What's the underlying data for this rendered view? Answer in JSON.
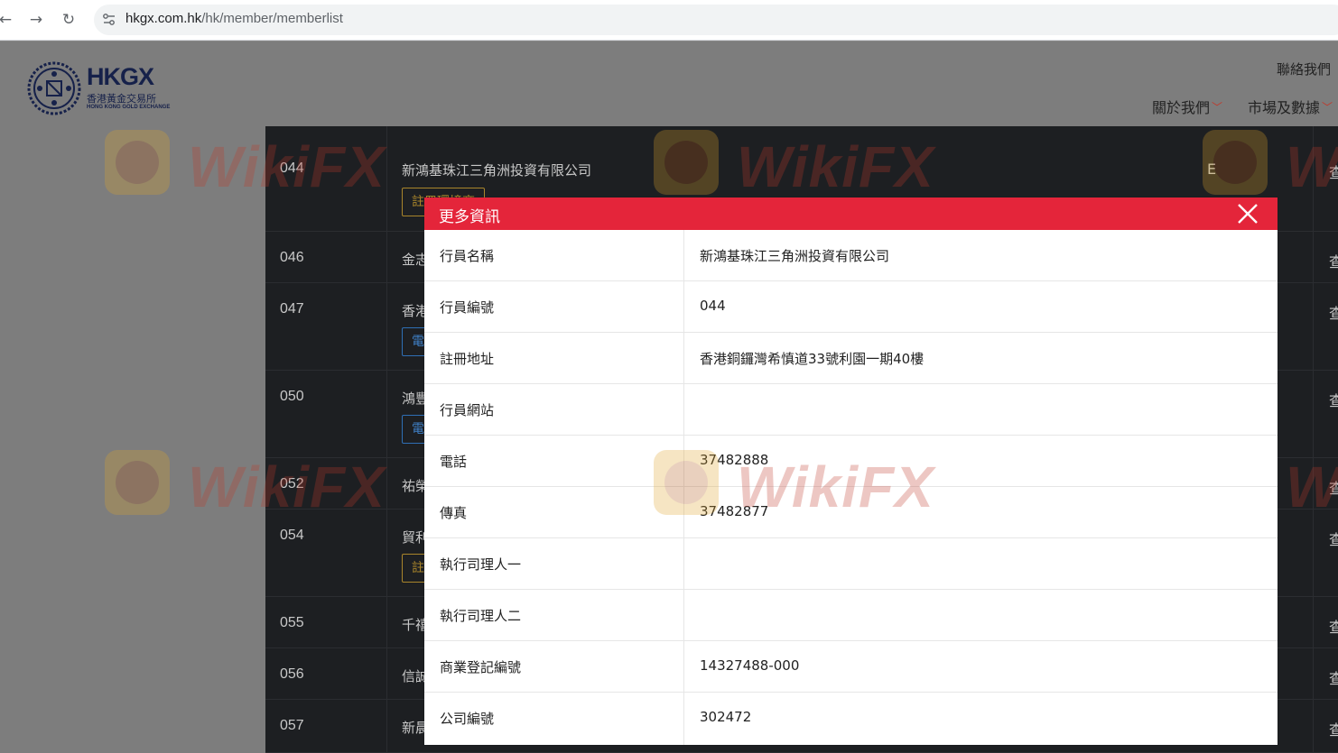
{
  "browser": {
    "url_host": "hkgx.com.hk",
    "url_path": "/hk/member/memberlist"
  },
  "header": {
    "logo_text": "HKGX",
    "logo_cn": "香港黃金交易所",
    "logo_en": "HONG KONG GOLD EXCHANGE",
    "contact": "聯絡我們",
    "nav": [
      {
        "label": "關於我們"
      },
      {
        "label": "市場及數據"
      }
    ]
  },
  "members": [
    {
      "num": "044",
      "name": "新鴻基珠江三角洲投資有限公司",
      "tag": "註冊環境商",
      "tag_type": "gold",
      "trail": "查",
      "extra": "E"
    },
    {
      "num": "046",
      "name": "金志",
      "tag": "",
      "tag_type": "",
      "trail": "查",
      "extra": ""
    },
    {
      "num": "047",
      "name": "香港",
      "tag": "電",
      "tag_type": "blue",
      "trail": "查",
      "extra": ""
    },
    {
      "num": "050",
      "name": "鴻豐",
      "tag": "電",
      "tag_type": "blue",
      "trail": "查",
      "extra": ""
    },
    {
      "num": "052",
      "name": "祐榮",
      "tag": "",
      "tag_type": "",
      "trail": "查",
      "extra": ""
    },
    {
      "num": "054",
      "name": "貿利",
      "tag": "註",
      "tag_type": "gold",
      "trail": "查",
      "extra": ""
    },
    {
      "num": "055",
      "name": "千禧",
      "tag": "",
      "tag_type": "",
      "trail": "查",
      "extra": ""
    },
    {
      "num": "056",
      "name": "信誠",
      "tag": "",
      "tag_type": "",
      "trail": "查",
      "extra": ""
    },
    {
      "num": "057",
      "name": "新晨",
      "tag": "",
      "tag_type": "",
      "trail": "查",
      "extra": ""
    }
  ],
  "watermark": "WikiFX",
  "modal": {
    "title": "更多資訊",
    "rows": [
      {
        "label": "行員名稱",
        "value": "新鴻基珠江三角洲投資有限公司"
      },
      {
        "label": "行員編號",
        "value": "044"
      },
      {
        "label": "註冊地址",
        "value": "香港銅鑼灣希慎道33號利園一期40樓"
      },
      {
        "label": "行員網站",
        "value": ""
      },
      {
        "label": "電話",
        "value": "37482888"
      },
      {
        "label": "傳真",
        "value": "37482877"
      },
      {
        "label": "執行司理人一",
        "value": ""
      },
      {
        "label": "執行司理人二",
        "value": ""
      },
      {
        "label": "商業登記編號",
        "value": "14327488-000"
      },
      {
        "label": "公司編號",
        "value": "302472"
      }
    ]
  },
  "colors": {
    "accent": "#e4253a",
    "table_bg": "#1d1f22",
    "logo_navy": "#16214a"
  }
}
